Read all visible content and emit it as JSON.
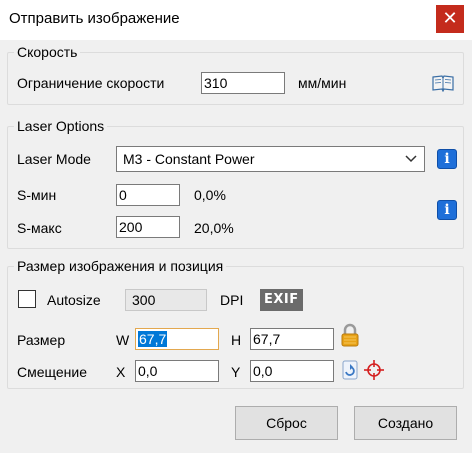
{
  "window": {
    "title": "Отправить изображение",
    "close_glyph": "✕"
  },
  "speed": {
    "legend": "Скорость",
    "limit_label": "Ограничение скорости",
    "limit_value": "310",
    "unit": "мм/мин",
    "help_icon": "book-icon"
  },
  "laser": {
    "legend": "Laser Options",
    "mode_label": "Laser Mode",
    "mode_value": "M3 - Constant Power",
    "info_glyph": "i",
    "s_min_label": "S-мин",
    "s_min_value": "0",
    "s_min_percent": "0,0%",
    "s_max_label": "S-макс",
    "s_max_value": "200",
    "s_max_percent": "20,0%"
  },
  "image": {
    "legend": "Размер изображения и позиция",
    "autosize_label": "Autosize",
    "autosize_checked": false,
    "dpi_value": "300",
    "dpi_label": "DPI",
    "exif_label": "EXIF",
    "size_label": "Размер",
    "w_label": "W",
    "w_value": "67,7",
    "h_label": "H",
    "h_value": "67,7",
    "offset_label": "Смещение",
    "x_label": "X",
    "x_value": "0,0",
    "y_label": "Y",
    "y_value": "0,0"
  },
  "buttons": {
    "reset": "Сброс",
    "create": "Создано"
  },
  "colors": {
    "accent": "#0078d7",
    "info": "#1e6fd9",
    "close": "#c42b1c",
    "lock": "#e8a317",
    "target": "#d42020"
  }
}
